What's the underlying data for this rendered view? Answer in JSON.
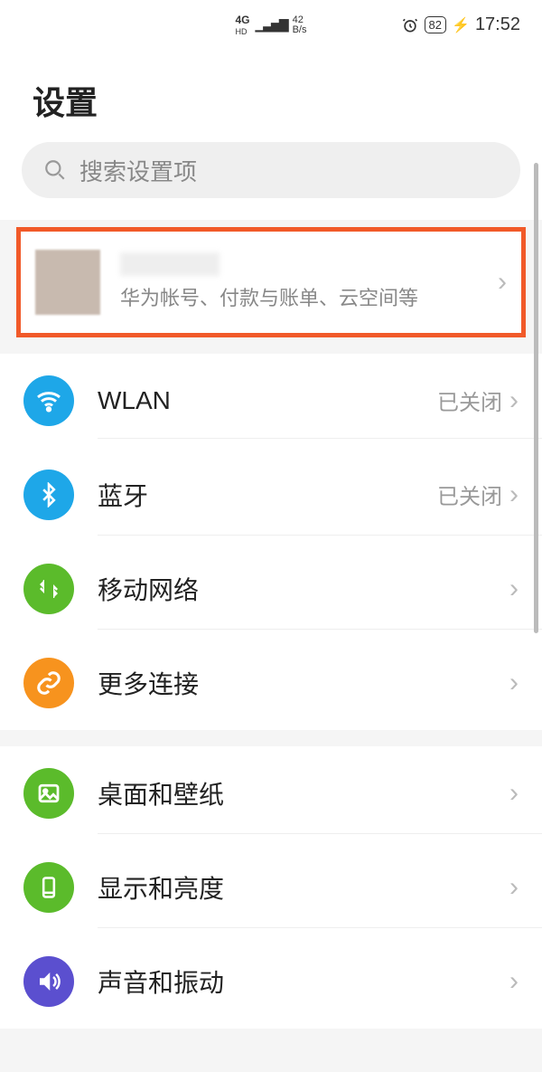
{
  "status": {
    "network_type": "4G",
    "network_sub": "HD",
    "speed_top": "42",
    "speed_unit": "B/s",
    "alarm": true,
    "battery": "82",
    "charging": true,
    "time": "17:52"
  },
  "header": {
    "title": "设置"
  },
  "search": {
    "placeholder": "搜索设置项"
  },
  "account": {
    "subtitle": "华为帐号、付款与账单、云空间等"
  },
  "groups": [
    {
      "items": [
        {
          "id": "wlan",
          "label": "WLAN",
          "value": "已关闭",
          "icon": "wifi",
          "color": "#1EA7E8"
        },
        {
          "id": "bluetooth",
          "label": "蓝牙",
          "value": "已关闭",
          "icon": "bluetooth",
          "color": "#1EA7E8"
        },
        {
          "id": "mobile",
          "label": "移动网络",
          "value": "",
          "icon": "arrows",
          "color": "#5BBB2B"
        },
        {
          "id": "more-conn",
          "label": "更多连接",
          "value": "",
          "icon": "link",
          "color": "#F7931E"
        }
      ]
    },
    {
      "items": [
        {
          "id": "wallpaper",
          "label": "桌面和壁纸",
          "value": "",
          "icon": "image",
          "color": "#5BBB2B"
        },
        {
          "id": "display",
          "label": "显示和亮度",
          "value": "",
          "icon": "phone",
          "color": "#5BBB2B"
        },
        {
          "id": "sound",
          "label": "声音和振动",
          "value": "",
          "icon": "speaker",
          "color": "#5B4FCF"
        }
      ]
    }
  ]
}
